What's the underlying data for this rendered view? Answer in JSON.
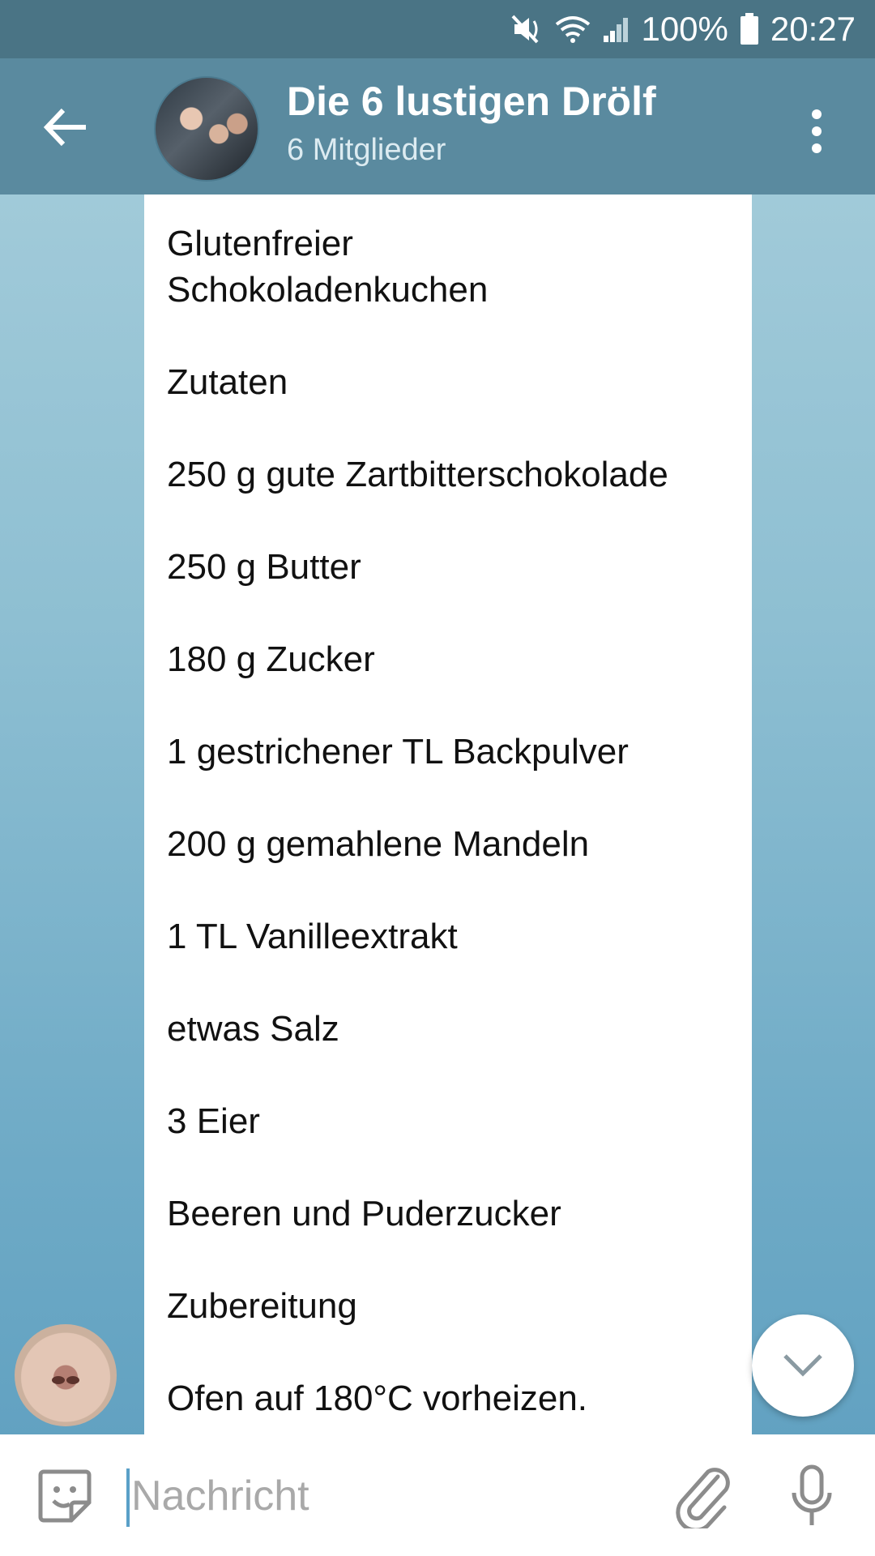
{
  "status_bar": {
    "battery": "100%",
    "time": "20:27",
    "icons": [
      "mute-icon",
      "wifi-icon",
      "signal-icon",
      "battery-icon"
    ]
  },
  "header": {
    "title": "Die 6 lustigen Drölf",
    "subtitle": "6 Mitglieder",
    "icons": [
      "back-arrow-icon",
      "group-avatar",
      "more-vert-icon"
    ]
  },
  "message": {
    "lines": [
      "Glutenfreier\nSchokoladenkuchen",
      "Zutaten",
      "250 g gute Zartbitterschokolade",
      "250 g Butter",
      "180 g Zucker",
      "1 gestrichener TL Backpulver",
      "200 g gemahlene Mandeln",
      "1 TL Vanilleextrakt",
      "etwas Salz",
      "3 Eier",
      "Beeren und Puderzucker",
      "Zubereitung",
      "Ofen auf 180°C vorheizen."
    ]
  },
  "composer": {
    "placeholder": "Nachricht",
    "value": "",
    "icons": [
      "sticker-icon",
      "paperclip-icon",
      "microphone-icon"
    ]
  },
  "scroll_down": {
    "icon": "chevron-down-icon"
  },
  "colors": {
    "status_bar": "#4a7485",
    "app_bar": "#5a8a9f",
    "sender_name": "#4caf50",
    "bubble": "#ffffff",
    "cursor": "#5aa0c8"
  }
}
